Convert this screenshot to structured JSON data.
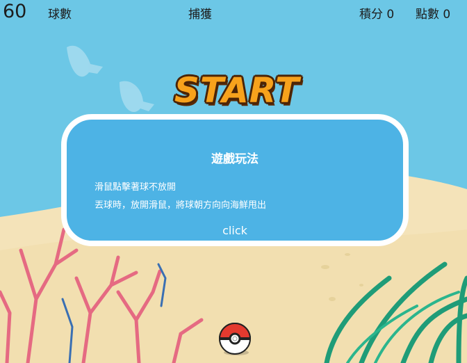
{
  "hud": {
    "timer": "60",
    "balls_label": "球數",
    "caught_label": "捕獲",
    "score_label": "積分",
    "score_value": "0",
    "points_label": "點數",
    "points_value": "0"
  },
  "start_title": "START",
  "instructions": {
    "title": "遊戲玩法",
    "line1": "滑鼠點擊著球不放開",
    "line2": "丟球時，放開滑鼠，將球朝方向向海鮮甩出",
    "button": "click"
  },
  "colors": {
    "sky": "#6cc7e6",
    "sand": "#f3e3b8",
    "panel": "#4db3e5",
    "coral": "#e56a82",
    "seaweed": "#1f9c78",
    "title": "#f7a21c"
  },
  "icons": {
    "ball": "pokeball-icon"
  }
}
